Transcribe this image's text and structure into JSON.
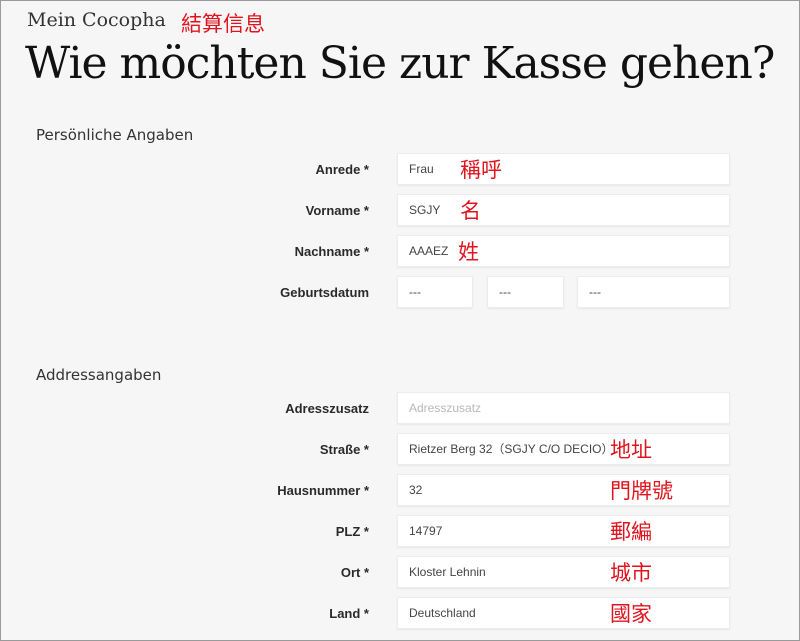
{
  "header": {
    "brand": "Mein Cocopha",
    "brand_annotation": "結算信息",
    "title": "Wie möchten Sie zur Kasse gehen?"
  },
  "personal": {
    "section_title": "Persönliche Angaben",
    "salutation": {
      "label": "Anrede *",
      "value": "Frau",
      "annotation": "稱呼"
    },
    "first_name": {
      "label": "Vorname *",
      "value": "SGJY",
      "annotation": "名"
    },
    "last_name": {
      "label": "Nachname *",
      "value": "AAAEZ",
      "annotation": "姓"
    },
    "birthdate": {
      "label": "Geburtsdatum",
      "day": "---",
      "month": "---",
      "year": "---"
    }
  },
  "address": {
    "section_title": "Addressangaben",
    "addition": {
      "label": "Adresszusatz",
      "placeholder": "Adresszusatz"
    },
    "street": {
      "label": "Straße *",
      "value": "Rietzer Berg 32（SGJY C/O DECIO）",
      "annotation": "地址"
    },
    "house_number": {
      "label": "Hausnummer *",
      "value": "32",
      "annotation": "門牌號"
    },
    "zip": {
      "label": "PLZ *",
      "value": "14797",
      "annotation": "郵編"
    },
    "city": {
      "label": "Ort *",
      "value": "Kloster Lehnin",
      "annotation": "城市"
    },
    "country": {
      "label": "Land *",
      "value": "Deutschland",
      "annotation": "國家"
    }
  }
}
